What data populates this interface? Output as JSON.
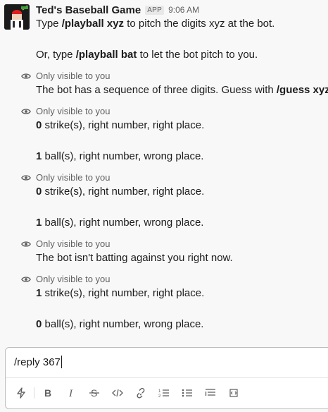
{
  "message": {
    "bot_name": "Ted's Baseball Game",
    "app_badge": "APP",
    "time": "9:06 AM",
    "intro": [
      {
        "pre": "Type ",
        "cmd": "/playball xyz",
        "post": " to pitch the digits xyz at the bot."
      },
      {
        "pre": "Or, type ",
        "cmd": "/playball bat",
        "post": " to let the bot pitch to you."
      }
    ]
  },
  "ephemeral": [
    {
      "label": "Only visible to you",
      "lines": [
        {
          "pre": "The bot has a sequence of three digits. Guess with ",
          "cmd": "/guess xyz",
          "post": "."
        }
      ]
    },
    {
      "label": "Only visible to you",
      "lines": [
        {
          "pre": "",
          "cmd": "0",
          "post": " strike(s), right number, right place."
        },
        {
          "pre": "",
          "cmd": "1",
          "post": " ball(s), right number, wrong place."
        }
      ]
    },
    {
      "label": "Only visible to you",
      "lines": [
        {
          "pre": "",
          "cmd": "0",
          "post": " strike(s), right number, right place."
        },
        {
          "pre": "",
          "cmd": "1",
          "post": " ball(s), right number, wrong place."
        }
      ]
    },
    {
      "label": "Only visible to you",
      "lines": [
        {
          "pre": "The bot isn't batting against you right now.",
          "cmd": "",
          "post": ""
        }
      ]
    },
    {
      "label": "Only visible to you",
      "lines": [
        {
          "pre": "",
          "cmd": "1",
          "post": " strike(s), right number, right place."
        },
        {
          "pre": "",
          "cmd": "0",
          "post": " ball(s), right number, wrong place."
        }
      ]
    }
  ],
  "composer": {
    "value": "/reply 367",
    "toolbar": [
      "shortcuts-icon",
      "bold-icon",
      "italic-icon",
      "strikethrough-icon",
      "code-icon",
      "link-icon",
      "ordered-list-icon",
      "bulleted-list-icon",
      "blockquote-icon",
      "code-block-icon"
    ]
  },
  "colors": {
    "background": "#f8f8f8",
    "text": "#1d1c1d",
    "muted": "#616061",
    "avatar_bg": "#1a1a1a",
    "avatar_cap": "#e01e1e"
  }
}
